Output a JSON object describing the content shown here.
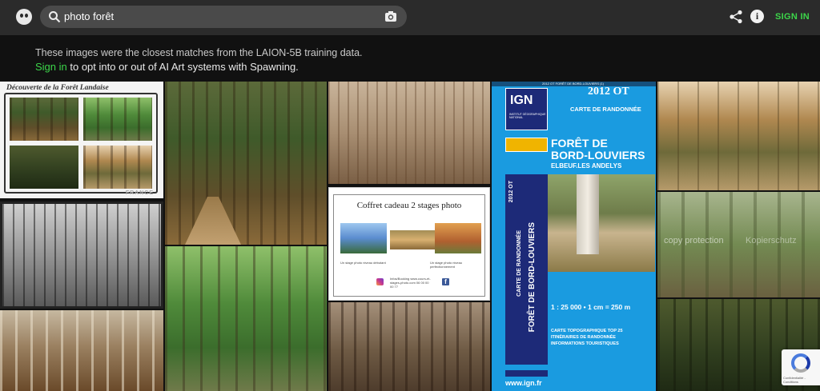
{
  "search": {
    "query": "photo forêt"
  },
  "header": {
    "signin_label": "SIGN IN"
  },
  "notice": {
    "line1": "These images were the closest matches from the LAION-5B training data.",
    "signin_link": "Sign in",
    "line2_rest": " to opt into or out of AI Art systems with Spawning."
  },
  "images": {
    "postcard": {
      "title": "Découverte de la Forêt Landaise",
      "footer": "FRANCE"
    },
    "coffret": {
      "title": "Coffret cadeau 2 stages photo",
      "caption_left": "Un stage photo niveau débutant",
      "caption_right": "Un stage photo niveau perfectionnement",
      "contact": "Infos/Booking www.cours-et-stages-photo.com 06 00 00 00 77"
    },
    "ign_map": {
      "header": "2012 OT FORÊT DE BORD-LOUVIERS (1)",
      "logo": "IGN",
      "logo_sub": "INSTITUT GÉOGRAPHIQUE NATIONAL",
      "code": "2012 OT",
      "series": "CARTE DE RANDONNÉE",
      "title_line1": "FORÊT DE",
      "title_line2": "BORD-LOUVIERS",
      "subtitle": "ELBEUF.LES ANDELYS",
      "side_label": "CARTE DE RANDONNÉE",
      "side_code": "2012 OT",
      "side_title": "FORÊT DE BORD-LOUVIERS",
      "scale": "1 : 25 000 • 1 cm = 250 m",
      "top25": "CARTE TOPOGRAPHIQUE TOP 25",
      "line1": "ITINÉRAIRES DE RANDONNÉE",
      "line2": "INFORMATIONS TOURISTIQUES",
      "url": "www.ign.fr"
    },
    "watermark": {
      "left": "copy protection",
      "right": "Kopierschutz"
    }
  },
  "recaptcha": {
    "text": "Confidentialité - Conditions"
  },
  "colors": {
    "accent_green": "#3cd64a",
    "topbar": "#2b2b2b",
    "ign_blue": "#1a9be0"
  },
  "icons": [
    "search-icon",
    "camera-icon",
    "share-icon",
    "info-icon",
    "logo-icon"
  ]
}
